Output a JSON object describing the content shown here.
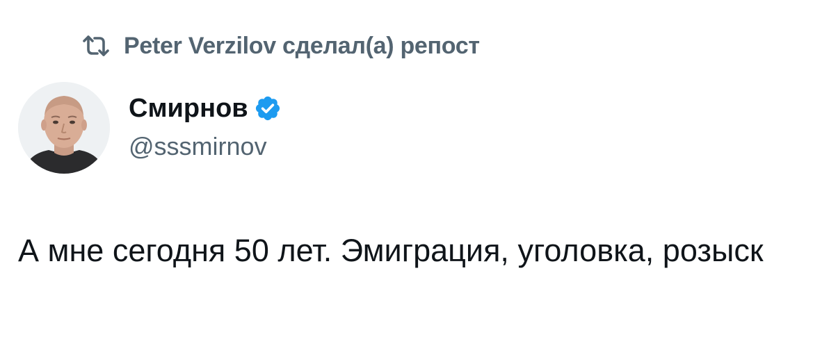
{
  "repost": {
    "text": "Peter Verzilov сделал(а) репост",
    "icon": "repost-icon"
  },
  "author": {
    "display_name": "Смирнов",
    "handle": "@sssmirnov",
    "verified": true,
    "verified_icon": "verified-badge-icon",
    "verified_color": "#1d9bf0"
  },
  "tweet": {
    "text": "А мне сегодня 50 лет. Эмиграция, уголовка, розыск"
  },
  "colors": {
    "primary_text": "#0f1419",
    "secondary_text": "#536471",
    "background": "#ffffff"
  }
}
